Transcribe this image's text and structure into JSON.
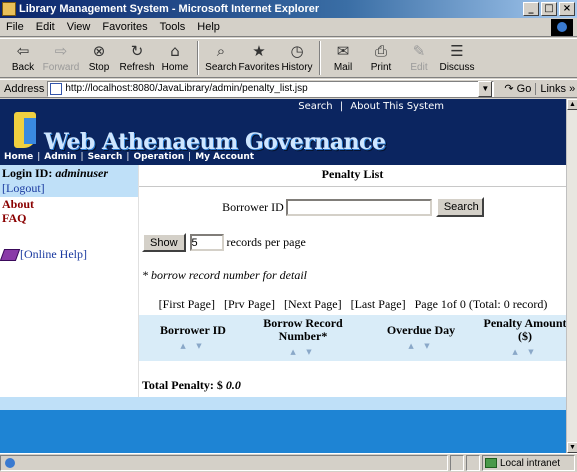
{
  "window": {
    "title": "Library Management System - Microsoft Internet Explorer",
    "controls": [
      "_",
      "□",
      "×"
    ]
  },
  "menu": [
    "File",
    "Edit",
    "View",
    "Favorites",
    "Tools",
    "Help"
  ],
  "toolbar": [
    {
      "label": "Back",
      "icon": "⇦",
      "enabled": true
    },
    {
      "label": "Forward",
      "icon": "⇨",
      "enabled": false
    },
    {
      "label": "Stop",
      "icon": "⊗",
      "enabled": true
    },
    {
      "label": "Refresh",
      "icon": "↻",
      "enabled": true
    },
    {
      "label": "Home",
      "icon": "⌂",
      "enabled": true
    },
    {
      "label": "Search",
      "icon": "⌕",
      "enabled": true
    },
    {
      "label": "Favorites",
      "icon": "★",
      "enabled": true
    },
    {
      "label": "History",
      "icon": "◷",
      "enabled": true
    },
    {
      "label": "Mail",
      "icon": "✉",
      "enabled": true
    },
    {
      "label": "Print",
      "icon": "⎙",
      "enabled": true
    },
    {
      "label": "Edit",
      "icon": "✎",
      "enabled": false
    },
    {
      "label": "Discuss",
      "icon": "☰",
      "enabled": true
    }
  ],
  "address": {
    "label": "Address",
    "url": "http://localhost:8080/JavaLibrary/admin/penalty_list.jsp",
    "go_label": "Go",
    "links_label": "Links »"
  },
  "banner": {
    "top_links": [
      "Search",
      "About This System"
    ],
    "logo_text": "Web Athenaeum Governance",
    "nav": [
      "Home",
      "Admin",
      "Search",
      "Operation",
      "My Account"
    ]
  },
  "sidebar": {
    "login_label": "Login ID:",
    "login_user": "adminuser",
    "logout": "[Logout]",
    "about": "About",
    "faq": "FAQ",
    "help": "[Online Help]"
  },
  "main": {
    "title": "Penalty List",
    "borrower_label": "Borrower ID",
    "borrower_value": "",
    "search_button": "Search",
    "show_button": "Show",
    "records_value": "5",
    "records_label": "records per page",
    "note": "* borrow record number for detail",
    "pager": {
      "first": "[First Page]",
      "prev": "[Prv Page]",
      "next": "[Next Page]",
      "last": "[Last Page]",
      "info": "Page 1of 0 (Total: 0 record)"
    },
    "columns": [
      {
        "label": "Borrower ID",
        "sort": "▲ ▼"
      },
      {
        "label": "Borrow Record Number*",
        "sort": "▲ ▼"
      },
      {
        "label": "Overdue Day",
        "sort": "▲ ▼"
      },
      {
        "label": "Penalty Amount ($)",
        "sort": "▲ ▼"
      }
    ],
    "total_label": "Total Penalty: $",
    "total_value": "0.0"
  },
  "status": {
    "zone": "Local intranet"
  },
  "colors": {
    "banner": "#0b2560",
    "accent_light": "#bfe0f8",
    "footer": "#1e84d4",
    "link": "#1a3aa0",
    "sidebar_link": "#8a0000"
  }
}
